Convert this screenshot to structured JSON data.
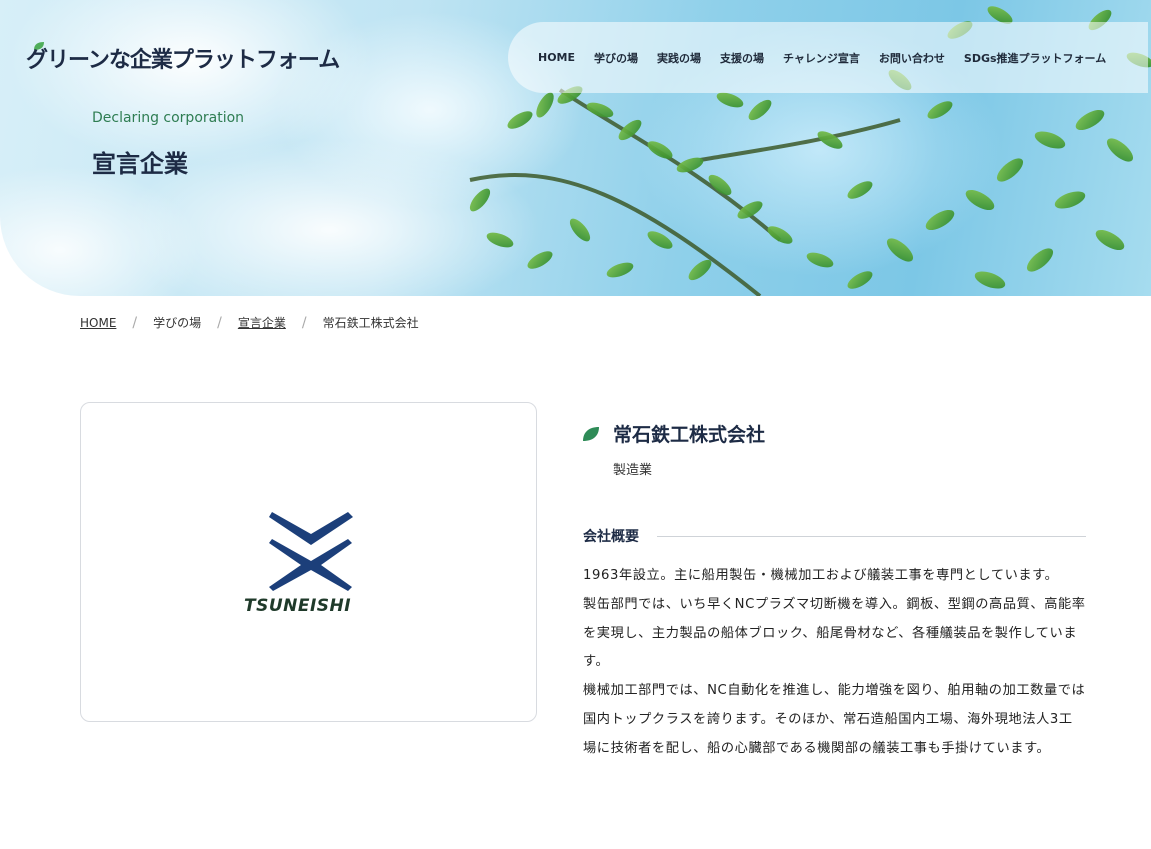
{
  "site": {
    "logo_text": "グリーンな企業プラットフォーム"
  },
  "nav": {
    "items": [
      {
        "label": "HOME"
      },
      {
        "label": "学びの場"
      },
      {
        "label": "実践の場"
      },
      {
        "label": "支援の場"
      },
      {
        "label": "チャレンジ宣言"
      },
      {
        "label": "お問い合わせ"
      },
      {
        "label": "SDGs推進プラットフォーム"
      }
    ]
  },
  "hero": {
    "subtitle": "Declaring corporation",
    "title": "宣言企業"
  },
  "breadcrumb": {
    "items": [
      {
        "label": "HOME"
      },
      {
        "label": "学びの場"
      },
      {
        "label": "宣言企業"
      },
      {
        "label": "常石鉄工株式会社"
      }
    ]
  },
  "company": {
    "logo_text": "TSUNEISHI",
    "name": "常石鉄工株式会社",
    "industry": "製造業",
    "overview_heading": "会社概要",
    "description": [
      "1963年設立。主に船用製缶・機械加工および艤装工事を専門としています。",
      "製缶部門では、いち早くNCプラズマ切断機を導入。鋼板、型鋼の高品質、高能率を実現し、主力製品の船体ブロック、船尾骨材など、各種艤装品を製作しています。",
      "機械加工部門では、NC自動化を推進し、能力増強を図り、舶用軸の加工数量では国内トップクラスを誇ります。そのほか、常石造船国内工場、海外現地法人3工場に技術者を配し、船の心臓部である機関部の艤装工事も手掛けています。"
    ]
  },
  "colors": {
    "brand_navy": "#1d2b45",
    "brand_green": "#2e7d52",
    "logo_blue": "#1c3f7a"
  }
}
